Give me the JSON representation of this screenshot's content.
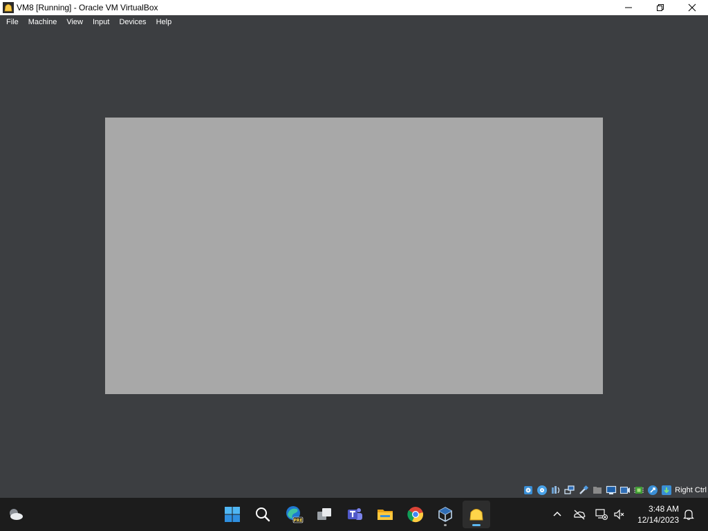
{
  "window": {
    "title": "VM8 [Running] - Oracle VM VirtualBox",
    "controls": [
      "minimize",
      "maximize",
      "close"
    ]
  },
  "menu": {
    "items": [
      "File",
      "Machine",
      "View",
      "Input",
      "Devices",
      "Help"
    ]
  },
  "vm": {
    "screen_color": "#a8a8a8"
  },
  "statusbar": {
    "icons": [
      "hard-disk-icon",
      "optical-drive-icon",
      "audio-icon",
      "network-icon",
      "usb-icon",
      "shared-folders-icon",
      "display-icon",
      "recording-icon",
      "cpu-icon",
      "mouse-integration-icon",
      "keyboard-icon"
    ],
    "host_key": "Right Ctrl"
  },
  "taskbar": {
    "apps": [
      "start-icon",
      "search-icon",
      "edge-preview-icon",
      "task-view-icon",
      "teams-icon",
      "file-explorer-icon",
      "chrome-icon",
      "virtualbox-icon",
      "vm-window-icon"
    ],
    "edge_badge": "PRE",
    "clock": {
      "time": "3:48 AM",
      "date": "12/14/2023"
    }
  },
  "colors": {
    "accent": "#5cb8f0",
    "background": "#3c3e41",
    "taskbar": "#1c1c1c"
  }
}
